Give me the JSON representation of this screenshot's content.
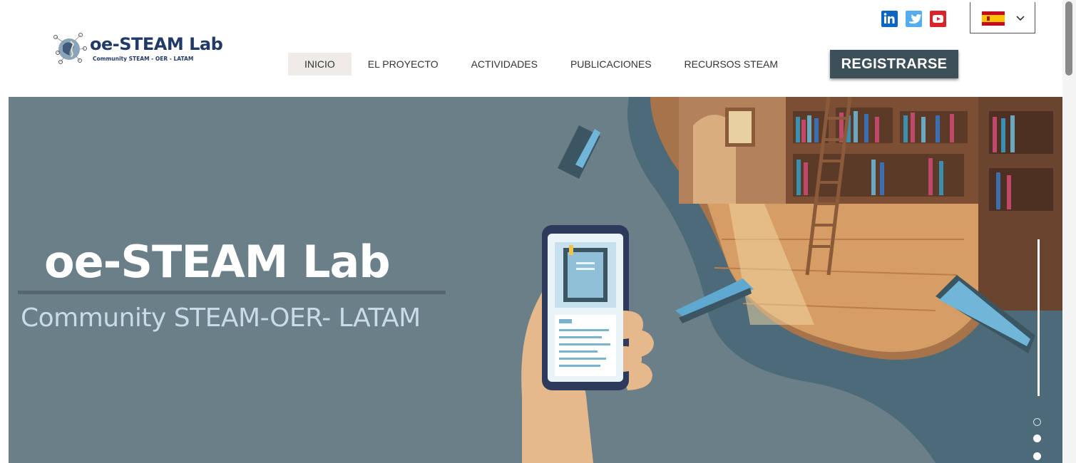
{
  "brand": {
    "name": "oe-STEAM Lab",
    "tagline": "Community STEAM - OER - LATAM"
  },
  "nav": {
    "items": [
      {
        "label": "INICIO",
        "active": true
      },
      {
        "label": "EL PROYECTO",
        "active": false
      },
      {
        "label": "ACTIVIDADES",
        "active": false
      },
      {
        "label": "PUBLICACIONES",
        "active": false
      },
      {
        "label": "RECURSOS STEAM",
        "active": false
      }
    ],
    "register_label": "REGISTRARSE"
  },
  "social": [
    {
      "name": "linkedin-icon",
      "glyph": "in",
      "color": "#0a66c2"
    },
    {
      "name": "twitter-icon",
      "color": "#55acee"
    },
    {
      "name": "youtube-icon",
      "color": "#d9252a"
    }
  ],
  "language": {
    "selected_flag": "spain-flag-icon"
  },
  "hero": {
    "title": "oe-STEAM Lab",
    "subtitle": "Community STEAM-OER- LATAM",
    "slides": 3,
    "active_slide": 1
  },
  "colors": {
    "brand_navy": "#223a66",
    "hero_bg": "#6b7f89",
    "register_bg": "#3d4f59",
    "nav_active_bg": "#efebe6"
  }
}
